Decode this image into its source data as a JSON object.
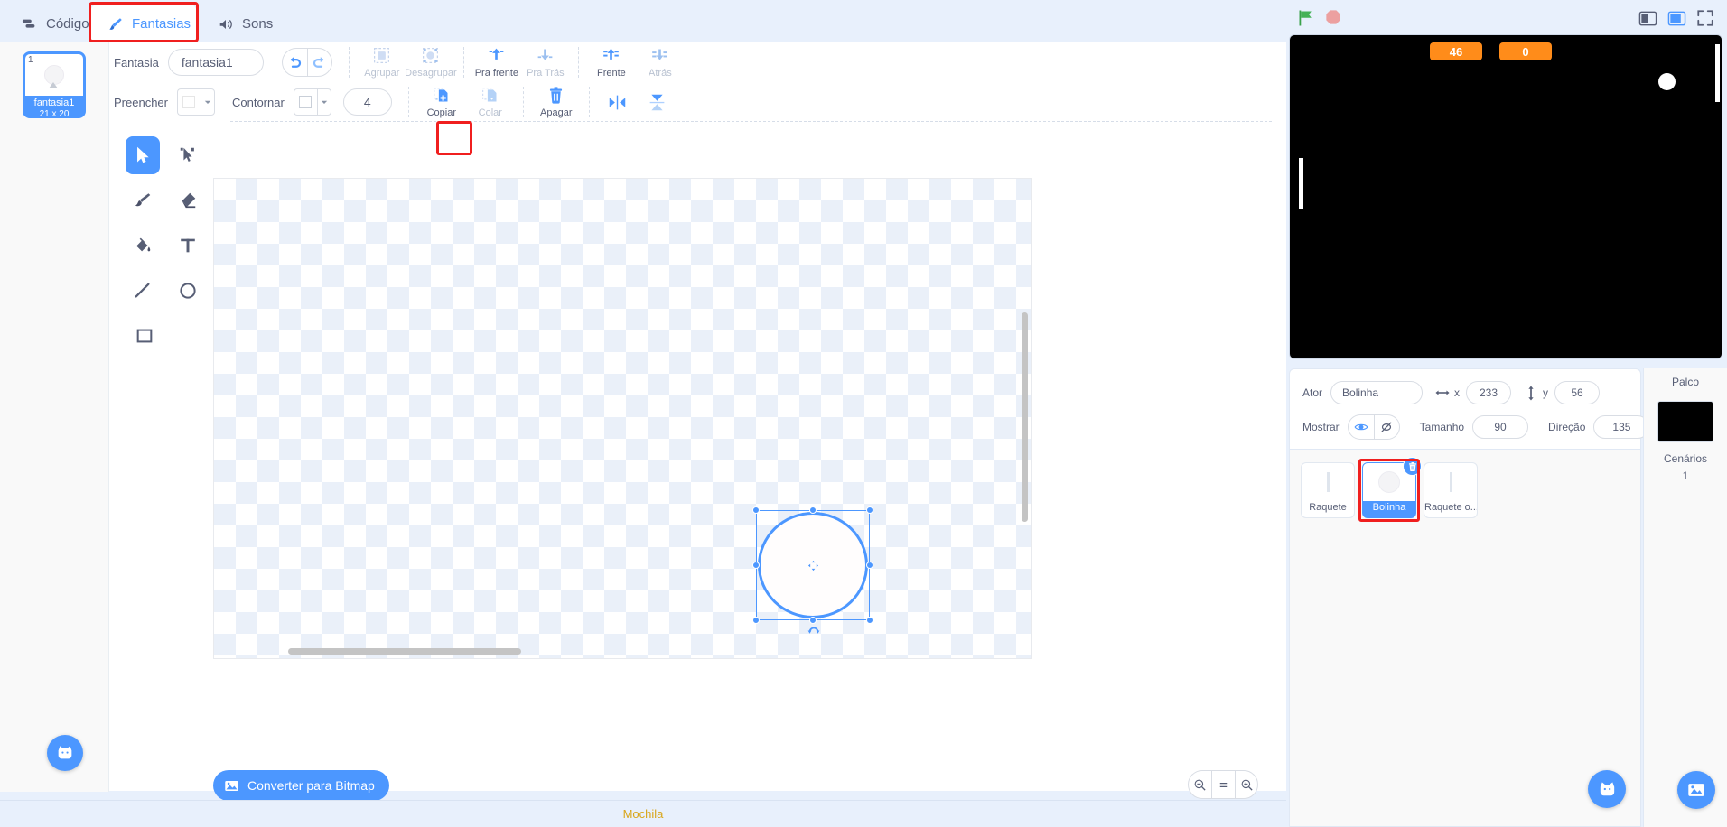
{
  "tabs": [
    {
      "label": "Código",
      "icon": "code-icon",
      "active": false
    },
    {
      "label": "Fantasias",
      "icon": "paintbrush-icon",
      "active": true
    },
    {
      "label": "Sons",
      "icon": "speaker-icon",
      "active": false
    }
  ],
  "costume_list": {
    "items": [
      {
        "number": "1",
        "name": "fantasia1",
        "size": "21 x 20",
        "selected": true
      }
    ]
  },
  "toolbar": {
    "costume_label": "Fantasia",
    "costume_name_value": "fantasia1",
    "fill_label": "Preencher",
    "outline_label": "Contornar",
    "stroke_width_value": "4",
    "undo_icon": "undo-icon",
    "redo_icon": "redo-icon",
    "row1_buttons": [
      {
        "label": "Agrupar",
        "icon": "group-icon",
        "disabled": true
      },
      {
        "label": "Desagrupar",
        "icon": "ungroup-icon",
        "disabled": true
      },
      {
        "label": "Pra frente",
        "icon": "forward-icon",
        "disabled": false
      },
      {
        "label": "Pra Trás",
        "icon": "backward-icon",
        "disabled": true
      },
      {
        "label": "Frente",
        "icon": "front-icon",
        "disabled": false
      },
      {
        "label": "Atrás",
        "icon": "back-icon",
        "disabled": true
      }
    ],
    "row2_buttons": [
      {
        "label": "Copiar",
        "icon": "copy-icon",
        "disabled": false
      },
      {
        "label": "Colar",
        "icon": "paste-icon",
        "disabled": true
      },
      {
        "label": "Apagar",
        "icon": "trash-icon",
        "disabled": false
      },
      {
        "label": "",
        "icon": "flip-horizontal-icon",
        "disabled": false
      },
      {
        "label": "",
        "icon": "flip-vertical-icon",
        "disabled": false
      }
    ]
  },
  "tools": [
    {
      "name": "select-tool",
      "icon": "arrow-cursor-icon",
      "selected": true
    },
    {
      "name": "reshape-tool",
      "icon": "reshape-icon",
      "selected": false
    },
    {
      "name": "brush-tool",
      "icon": "paintbrush-icon",
      "selected": false
    },
    {
      "name": "eraser-tool",
      "icon": "eraser-icon",
      "selected": false
    },
    {
      "name": "fill-tool",
      "icon": "paint-bucket-icon",
      "selected": false
    },
    {
      "name": "text-tool",
      "icon": "text-icon",
      "selected": false
    },
    {
      "name": "line-tool",
      "icon": "line-icon",
      "selected": false
    },
    {
      "name": "circle-tool",
      "icon": "circle-icon",
      "selected": false
    },
    {
      "name": "rectangle-tool",
      "icon": "rectangle-icon",
      "selected": false
    }
  ],
  "canvas": {
    "convert_button_label": "Converter para Bitmap",
    "zoom_out_label": "zoom-out-icon",
    "zoom_reset_label": "zoom-reset-icon",
    "zoom_in_label": "zoom-in-icon"
  },
  "backpack": {
    "label": "Mochila"
  },
  "stage": {
    "green_flag_icon": "green-flag-icon",
    "stop_icon": "stop-icon",
    "small_stage_icon": "small-stage-icon",
    "large_stage_icon": "large-stage-icon",
    "fullscreen_icon": "fullscreen-icon",
    "score_left": "46",
    "score_right": "0"
  },
  "sprite_info": {
    "sprite_label": "Ator",
    "sprite_name": "Bolinha",
    "x_label": "x",
    "x_value": "233",
    "y_label": "y",
    "y_value": "56",
    "show_label": "Mostrar",
    "show_icon": "eye-icon",
    "hide_icon": "eye-slash-icon",
    "size_label": "Tamanho",
    "size_value": "90",
    "direction_label": "Direção",
    "direction_value": "135"
  },
  "sprites": [
    {
      "name": "Raquete",
      "selected": false,
      "thumb": "paddle-thumb"
    },
    {
      "name": "Bolinha",
      "selected": true,
      "thumb": "ball-thumb"
    },
    {
      "name": "Raquete o...",
      "selected": false,
      "thumb": "paddle-thumb"
    }
  ],
  "stage_selector": {
    "title": "Palco",
    "backdrops_label": "Cenários",
    "backdrops_count": "1"
  },
  "colors": {
    "accent": "#4c97ff",
    "highlight": "#f01f1f",
    "badge": "#ff8c1a",
    "panel_bg": "#e8f0fc",
    "text": "#575e75"
  }
}
